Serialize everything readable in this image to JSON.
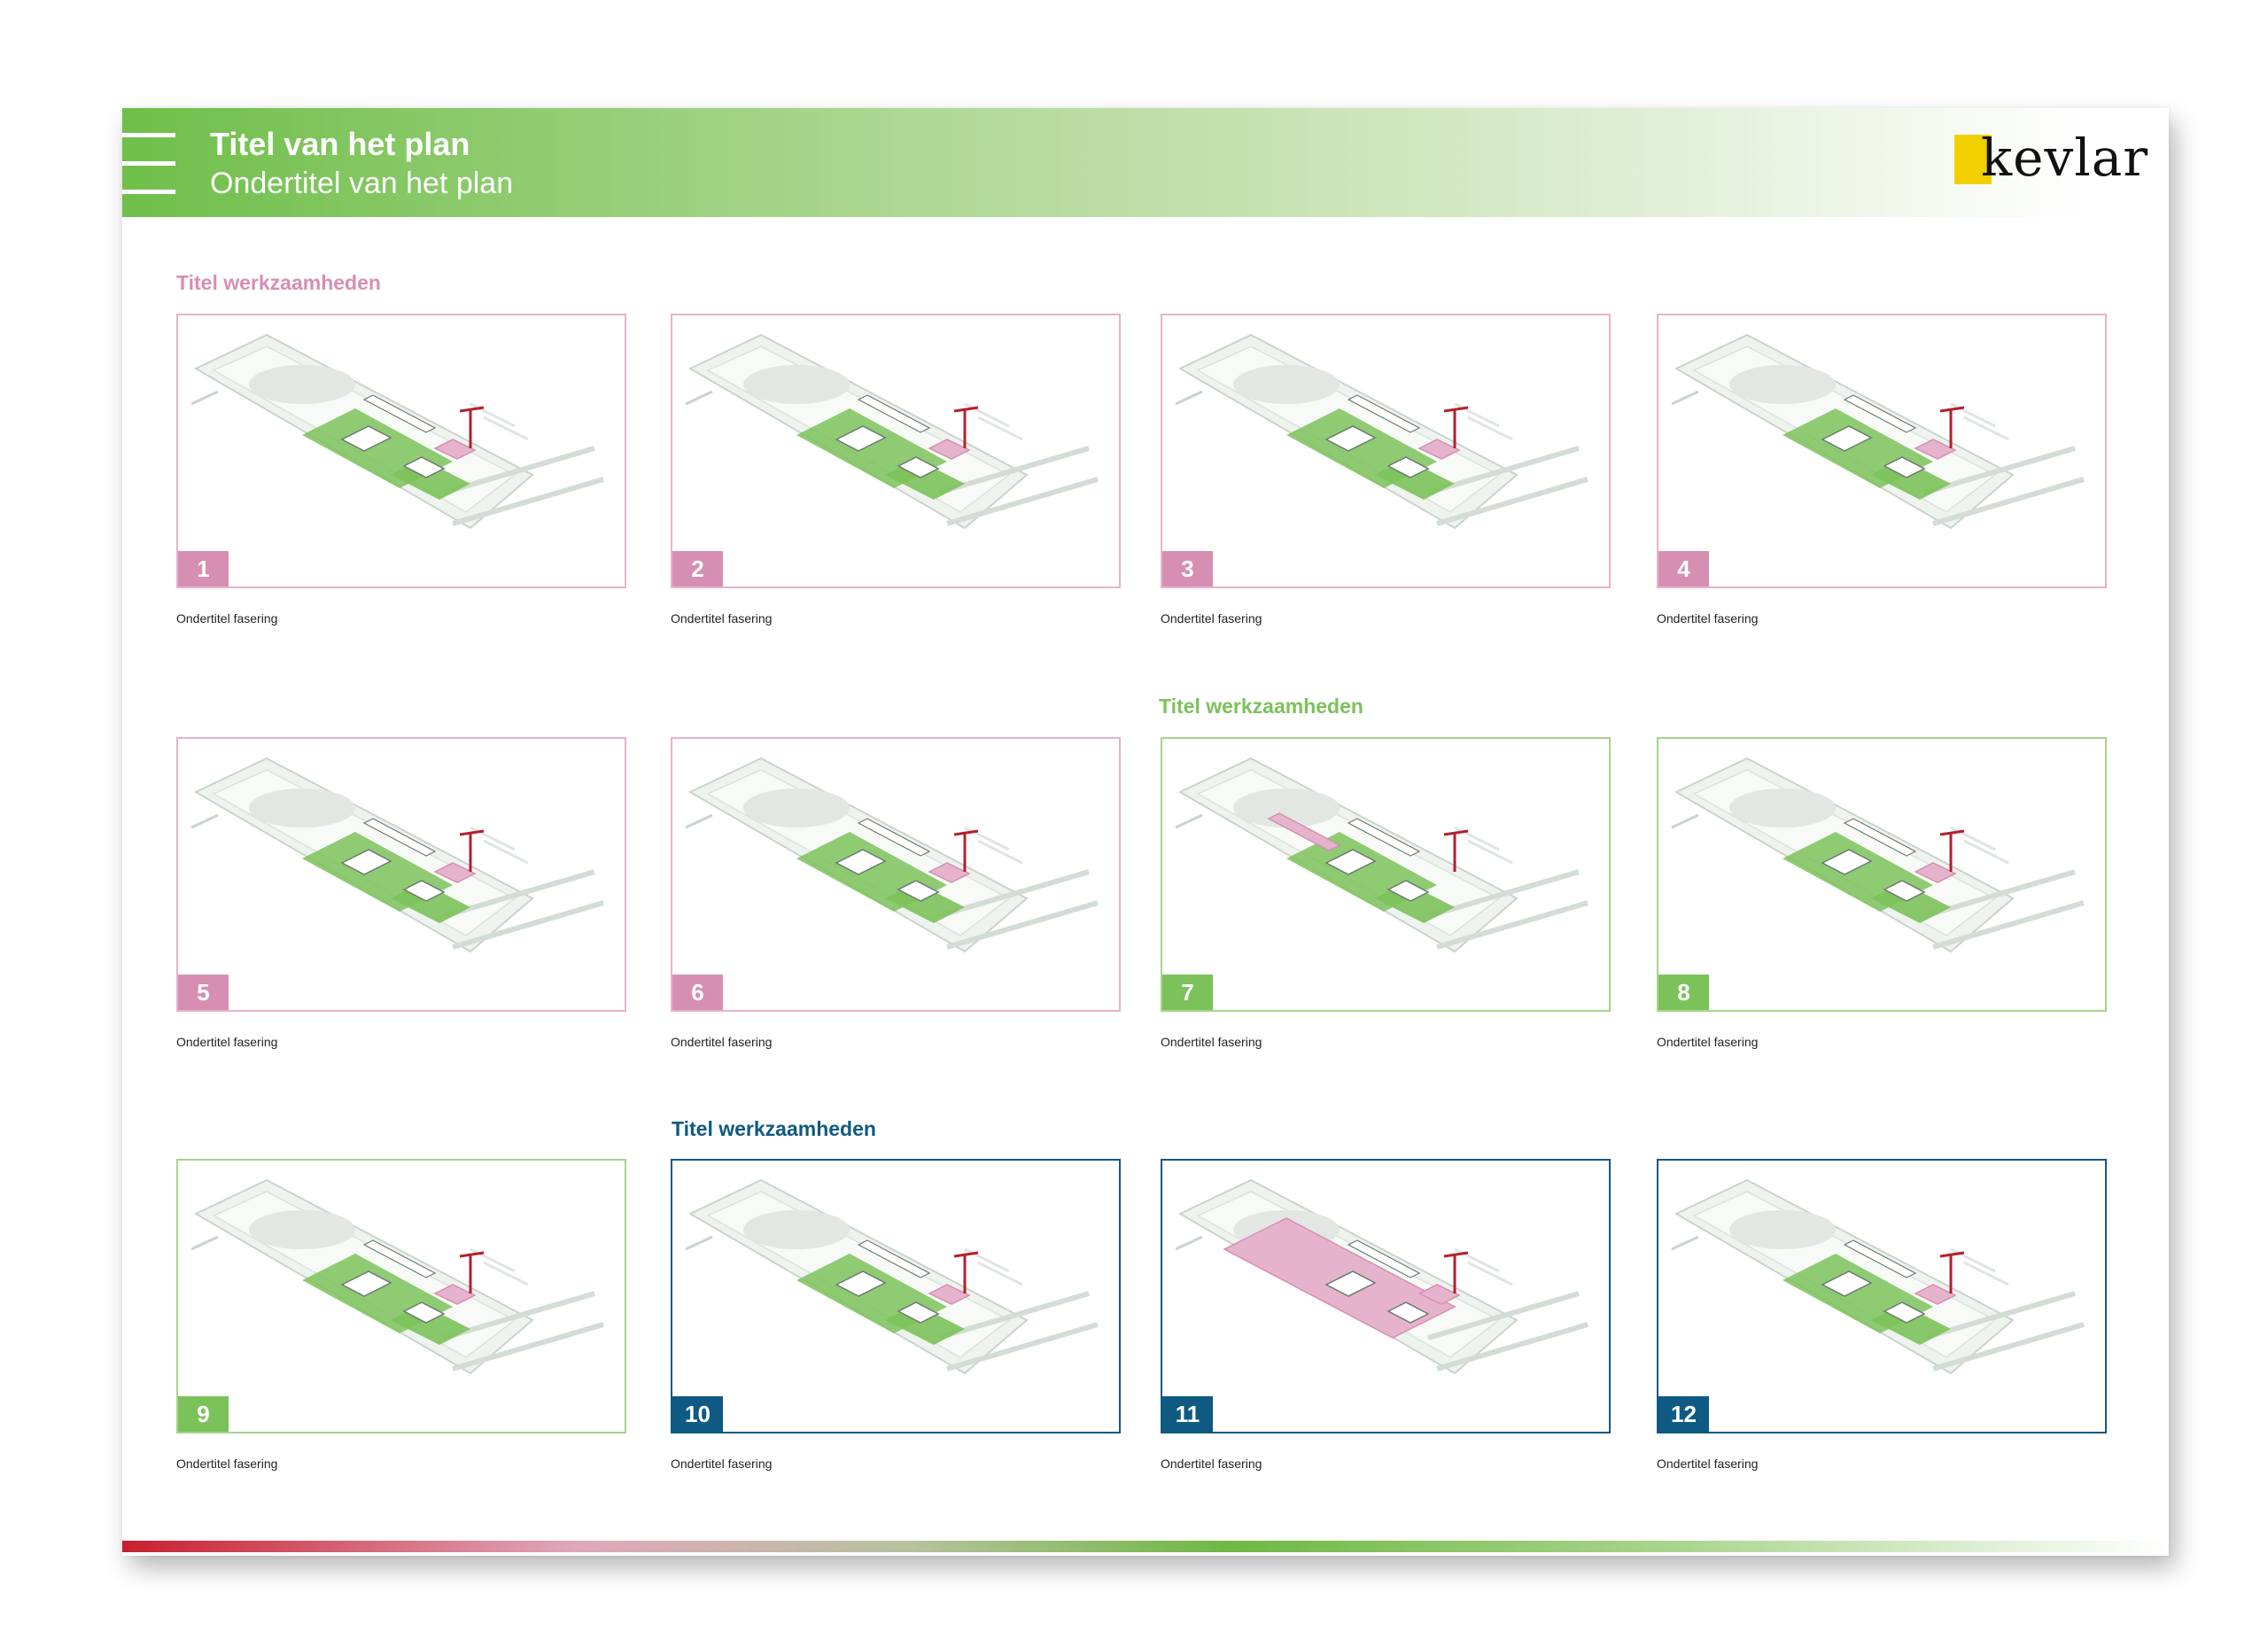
{
  "header": {
    "title": "Titel van het plan",
    "subtitle": "Ondertitel van het plan",
    "logo_text": "kevlar"
  },
  "colors": {
    "pink": "#d68fb3",
    "pink_light": "#e6b3cc",
    "green": "#7cc25a",
    "green_light": "#a6d48c",
    "blue": "#0f5a82",
    "crane_red": "#b3202e",
    "logo_yellow": "#f2d000"
  },
  "sections": [
    {
      "title": "Titel werkzaamheden",
      "theme": "pink"
    },
    {
      "title": "Titel werkzaamheden",
      "theme": "green"
    },
    {
      "title": "Titel werkzaamheden",
      "theme": "blue"
    }
  ],
  "phases": [
    {
      "number": "1",
      "caption": "Ondertitel fasering",
      "theme": "pink"
    },
    {
      "number": "2",
      "caption": "Ondertitel fasering",
      "theme": "pink"
    },
    {
      "number": "3",
      "caption": "Ondertitel fasering",
      "theme": "pink"
    },
    {
      "number": "4",
      "caption": "Ondertitel fasering",
      "theme": "pink"
    },
    {
      "number": "5",
      "caption": "Ondertitel fasering",
      "theme": "pink"
    },
    {
      "number": "6",
      "caption": "Ondertitel fasering",
      "theme": "pink"
    },
    {
      "number": "7",
      "caption": "Ondertitel fasering",
      "theme": "green"
    },
    {
      "number": "8",
      "caption": "Ondertitel fasering",
      "theme": "green"
    },
    {
      "number": "9",
      "caption": "Ondertitel fasering",
      "theme": "green"
    },
    {
      "number": "10",
      "caption": "Ondertitel fasering",
      "theme": "blue"
    },
    {
      "number": "11",
      "caption": "Ondertitel fasering",
      "theme": "blue"
    },
    {
      "number": "12",
      "caption": "Ondertitel fasering",
      "theme": "blue"
    }
  ]
}
